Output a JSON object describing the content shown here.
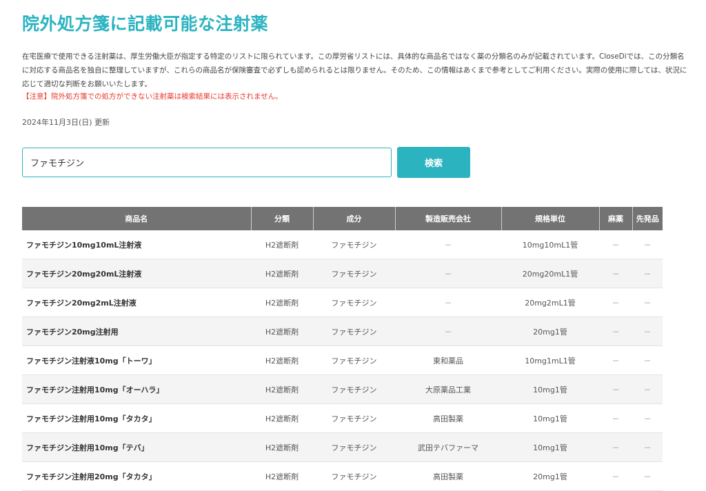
{
  "page": {
    "title": "院外処方箋に記載可能な注射薬",
    "intro": "在宅医療で使用できる注射薬は、厚生労働大臣が指定する特定のリストに限られています。この厚労省リストには、具体的な商品名ではなく薬の分類名のみが記載されています。CloseDiでは、この分類名に対応する商品名を独自に整理していますが、これらの商品名が保険審査で必ずしも認められるとは限りません。そのため、この情報はあくまで参考としてご利用ください。実際の使用に際しては、状況に応じて適切な判断をお願いいたします。",
    "warning": "【注意】院外処方箋での処方ができない注射薬は検索結果には表示されません。",
    "updated": "2024年11月3日(日) 更新"
  },
  "search": {
    "value": "ファモチジン",
    "button_label": "検索"
  },
  "table": {
    "headers": [
      "商品名",
      "分類",
      "成分",
      "製造販売会社",
      "規格単位",
      "麻薬",
      "先発品"
    ],
    "rows": [
      [
        "ファモチジン10mg10mL注射液",
        "H2遮断剤",
        "ファモチジン",
        "－",
        "10mg10mL1管",
        "－",
        "－"
      ],
      [
        "ファモチジン20mg20mL注射液",
        "H2遮断剤",
        "ファモチジン",
        "－",
        "20mg20mL1管",
        "－",
        "－"
      ],
      [
        "ファモチジン20mg2mL注射液",
        "H2遮断剤",
        "ファモチジン",
        "－",
        "20mg2mL1管",
        "－",
        "－"
      ],
      [
        "ファモチジン20mg注射用",
        "H2遮断剤",
        "ファモチジン",
        "－",
        "20mg1管",
        "－",
        "－"
      ],
      [
        "ファモチジン注射液10mg「トーワ」",
        "H2遮断剤",
        "ファモチジン",
        "東和薬品",
        "10mg1mL1管",
        "－",
        "－"
      ],
      [
        "ファモチジン注射用10mg「オーハラ」",
        "H2遮断剤",
        "ファモチジン",
        "大原薬品工業",
        "10mg1管",
        "－",
        "－"
      ],
      [
        "ファモチジン注射用10mg「タカタ」",
        "H2遮断剤",
        "ファモチジン",
        "高田製薬",
        "10mg1管",
        "－",
        "－"
      ],
      [
        "ファモチジン注射用10mg「テバ」",
        "H2遮断剤",
        "ファモチジン",
        "武田テバファーマ",
        "10mg1管",
        "－",
        "－"
      ],
      [
        "ファモチジン注射用20mg「タカタ」",
        "H2遮断剤",
        "ファモチジン",
        "高田製薬",
        "20mg1管",
        "－",
        "－"
      ]
    ]
  },
  "colors": {
    "accent": "#2bb3c0",
    "warning": "#e8372c",
    "table_header": "#737373"
  }
}
